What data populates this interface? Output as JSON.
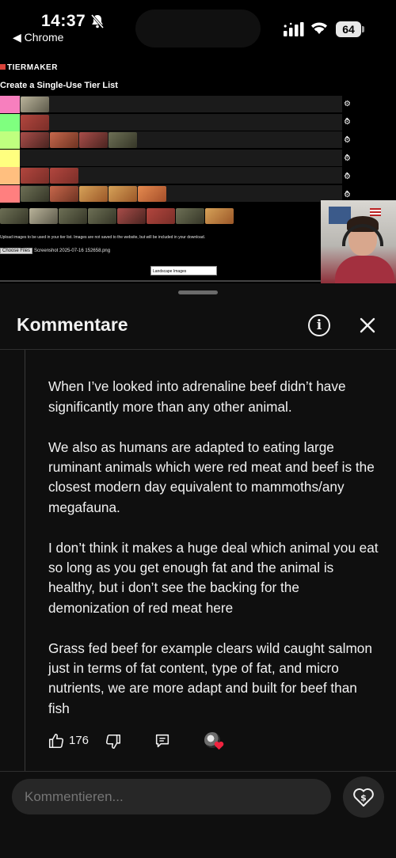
{
  "status_bar": {
    "time": "14:37",
    "back_app": "◀ Chrome",
    "battery": "64",
    "icons": [
      "bell-slash-icon",
      "signal-icon",
      "wifi-icon",
      "battery-icon"
    ]
  },
  "video": {
    "site_logo": "TIERMAKER",
    "page_title": "Create a Single-Use Tier List",
    "tier_colors": [
      "#f77fbe",
      "#7fff7f",
      "#bfff7f",
      "#ffff7f",
      "#ffbf7f",
      "#ff7f7f"
    ],
    "upload_note": "Upload images to be used in your tier list. Images are not saved to the website, but will be included in your download.",
    "choose_files": "Choose Files",
    "file_name": "Screenshot 2025-07-16 152658.png",
    "select_value": "Landscape Images"
  },
  "comments": {
    "title": "Kommentare",
    "paragraphs": [
      "When I’ve looked into adrenaline beef didn’t have significantly more than any other animal.",
      "We also as humans are adapted to eating large ruminant animals which were red meat and beef is the closest modern day equivalent to mammoths/any megafauna.",
      "I don’t think it makes a huge deal which animal you eat so long as you get enough fat and the animal is healthy, but i don’t see the backing for the demonization of red meat here",
      "Grass fed beef for example clears wild caught salmon just in terms of fat content, type of fat, and micro nutrients, we are more adapt and built for beef than fish"
    ],
    "like_count": "176",
    "input_placeholder": "Kommentieren..."
  }
}
